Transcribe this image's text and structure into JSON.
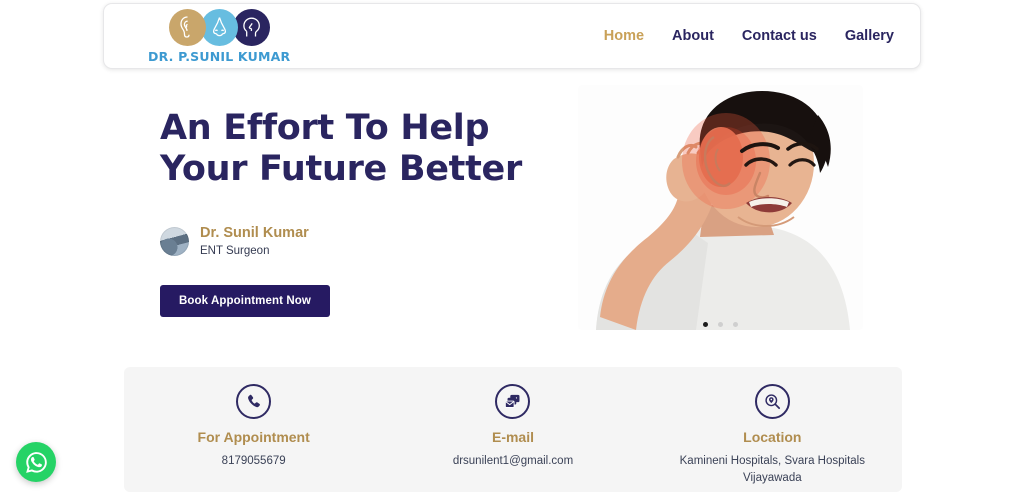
{
  "header": {
    "logo": {
      "text": "DR. P.SUNIL KUMAR",
      "circles": [
        {
          "name": "ear-icon",
          "color": "#c9a66b"
        },
        {
          "name": "nose-icon",
          "color": "#67bde0"
        },
        {
          "name": "throat-head-icon",
          "color": "#2a2560"
        }
      ]
    },
    "nav": [
      {
        "label": "Home",
        "active": true
      },
      {
        "label": "About",
        "active": false
      },
      {
        "label": "Contact us",
        "active": false
      },
      {
        "label": "Gallery",
        "active": false
      }
    ]
  },
  "hero": {
    "title_line1": "An Effort To Help",
    "title_line2": "Your Future Better",
    "doctor_name": "Dr. Sunil Kumar",
    "doctor_role": "ENT Surgeon",
    "cta_label": "Book Appointment Now",
    "image_alt": "person holding painful ear",
    "carousel": {
      "total": 3,
      "active_index": 0
    }
  },
  "info": {
    "cards": [
      {
        "icon": "phone-icon",
        "title": "For Appointment",
        "value": "8179055679"
      },
      {
        "icon": "email-icon",
        "title": "E-mail",
        "value": "drsunilent1@gmail.com"
      },
      {
        "icon": "location-search-icon",
        "title": "Location",
        "value": "Kamineni Hospitals, Svara Hospitals Vijayawada"
      }
    ]
  },
  "floating": {
    "whatsapp_label": "WhatsApp"
  },
  "colors": {
    "navy": "#2a2560",
    "gold": "#b08d4f",
    "logo_blue": "#3d9ad1",
    "whatsapp_green": "#25d366",
    "panel_gray": "#f5f5f5"
  }
}
